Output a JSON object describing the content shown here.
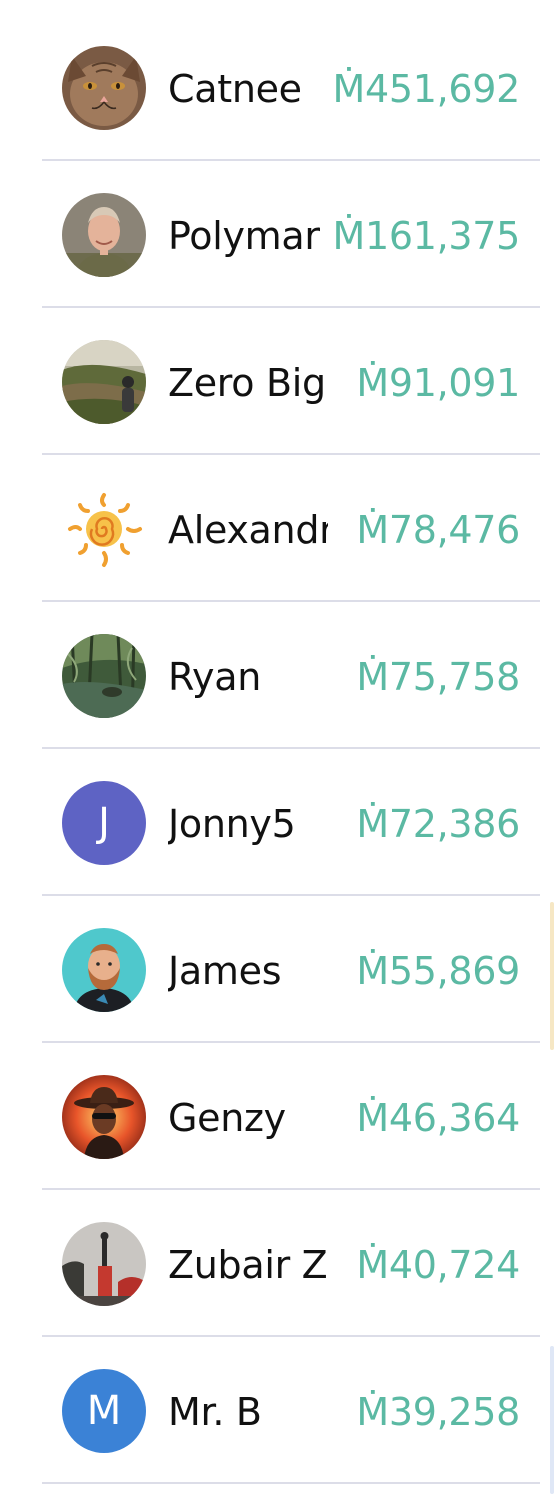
{
  "currency_symbol": "Ṁ",
  "colors": {
    "amount": "#5bb9a3",
    "divider": "#dcdde8",
    "name": "#111111"
  },
  "leaderboard": [
    {
      "name": "Catnee",
      "amount": "Ṁ451,692",
      "avatar": "cat-avatar"
    },
    {
      "name": "Polymar",
      "amount": "Ṁ161,375",
      "avatar": "man-portrait-avatar"
    },
    {
      "name": "Zero Big",
      "amount": "Ṁ91,091",
      "avatar": "landscape-photo-avatar"
    },
    {
      "name": "Alexandr",
      "amount": "Ṁ78,476",
      "avatar": "sun-avatar"
    },
    {
      "name": "Ryan",
      "amount": "Ṁ75,758",
      "avatar": "forest-photo-avatar"
    },
    {
      "name": "Jonny5",
      "amount": "Ṁ72,386",
      "avatar": "initial-avatar",
      "initial": "J",
      "avatar_color": "#5e63c4"
    },
    {
      "name": "James",
      "amount": "Ṁ55,869",
      "avatar": "bearded-man-avatar"
    },
    {
      "name": "Genzy",
      "amount": "Ṁ46,364",
      "avatar": "cowboy-avatar"
    },
    {
      "name": "Zubair Z",
      "amount": "Ṁ40,724",
      "avatar": "statue-photo-avatar"
    },
    {
      "name": "Mr. B",
      "amount": "Ṁ39,258",
      "avatar": "initial-avatar",
      "initial": "M",
      "avatar_color": "#3b82d6"
    }
  ]
}
